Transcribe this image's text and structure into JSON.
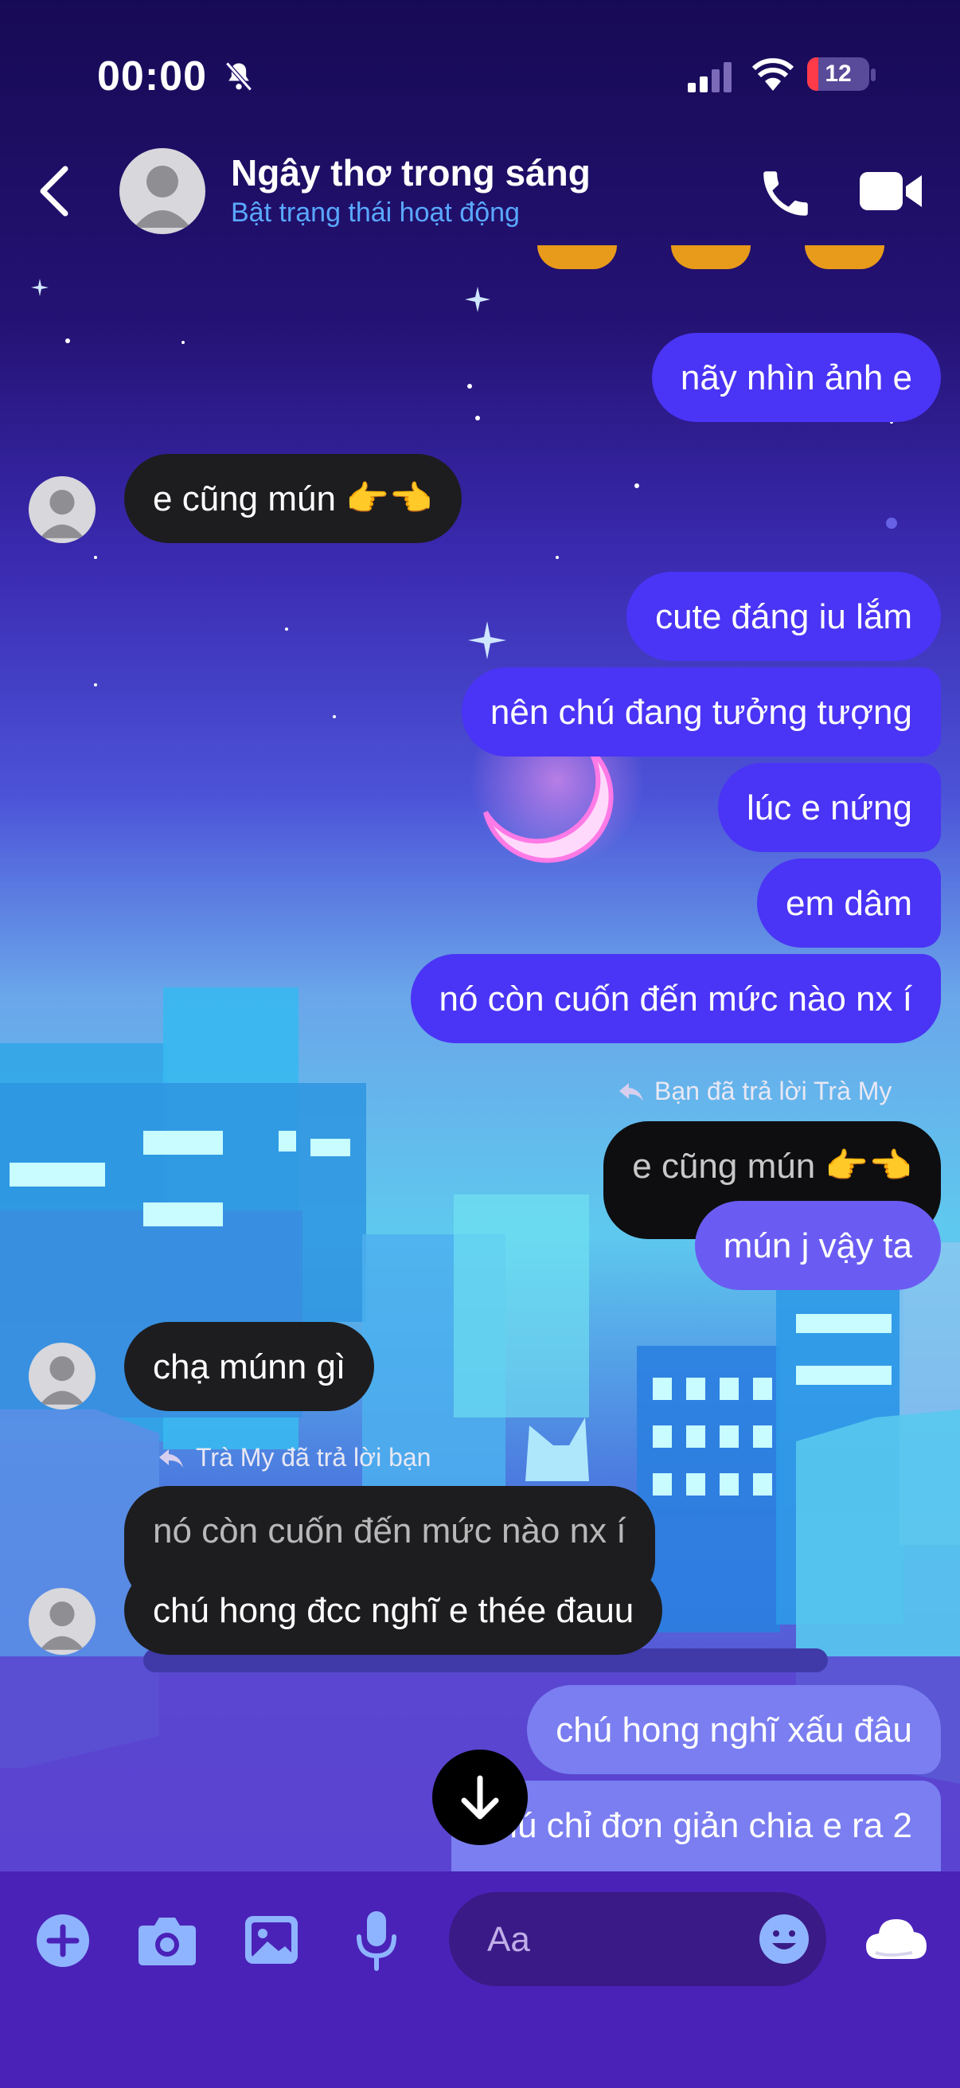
{
  "status_bar": {
    "time": "00:00",
    "battery": "12"
  },
  "header": {
    "name": "Ngây thơ trong sáng",
    "status": "Bật trạng thái hoạt động"
  },
  "messages": [
    {
      "dir": "out",
      "text": "nãy nhìn ảnh e"
    },
    {
      "dir": "in",
      "text": "e cũng mún 👉👈"
    },
    {
      "dir": "out",
      "text": "cute đáng iu lắm"
    },
    {
      "dir": "out",
      "text": "nên chú đang tưởng tượng"
    },
    {
      "dir": "out",
      "text": "lúc e nứng"
    },
    {
      "dir": "out",
      "text": "em dâm"
    },
    {
      "dir": "out",
      "text": "nó còn cuốn đến mức nào nx í"
    },
    {
      "dir": "out",
      "reply_label": "Bạn đã trả lời Trà My",
      "quoted": "e cũng mún 👉👈",
      "text": "mún j vậy ta"
    },
    {
      "dir": "in",
      "text": "chạ múnn gì"
    },
    {
      "dir": "in",
      "reply_label": "Trà My đã trả lời bạn",
      "quoted": "nó còn cuốn đến mức nào nx í",
      "text": "chú hong đcc nghĩ e thée đauu"
    },
    {
      "dir": "out",
      "text": "chú hong nghĩ xấu đâu"
    },
    {
      "dir": "out",
      "text": "chú chỉ đơn giản chia e ra 2"
    }
  ],
  "composer": {
    "placeholder": "Aa"
  }
}
